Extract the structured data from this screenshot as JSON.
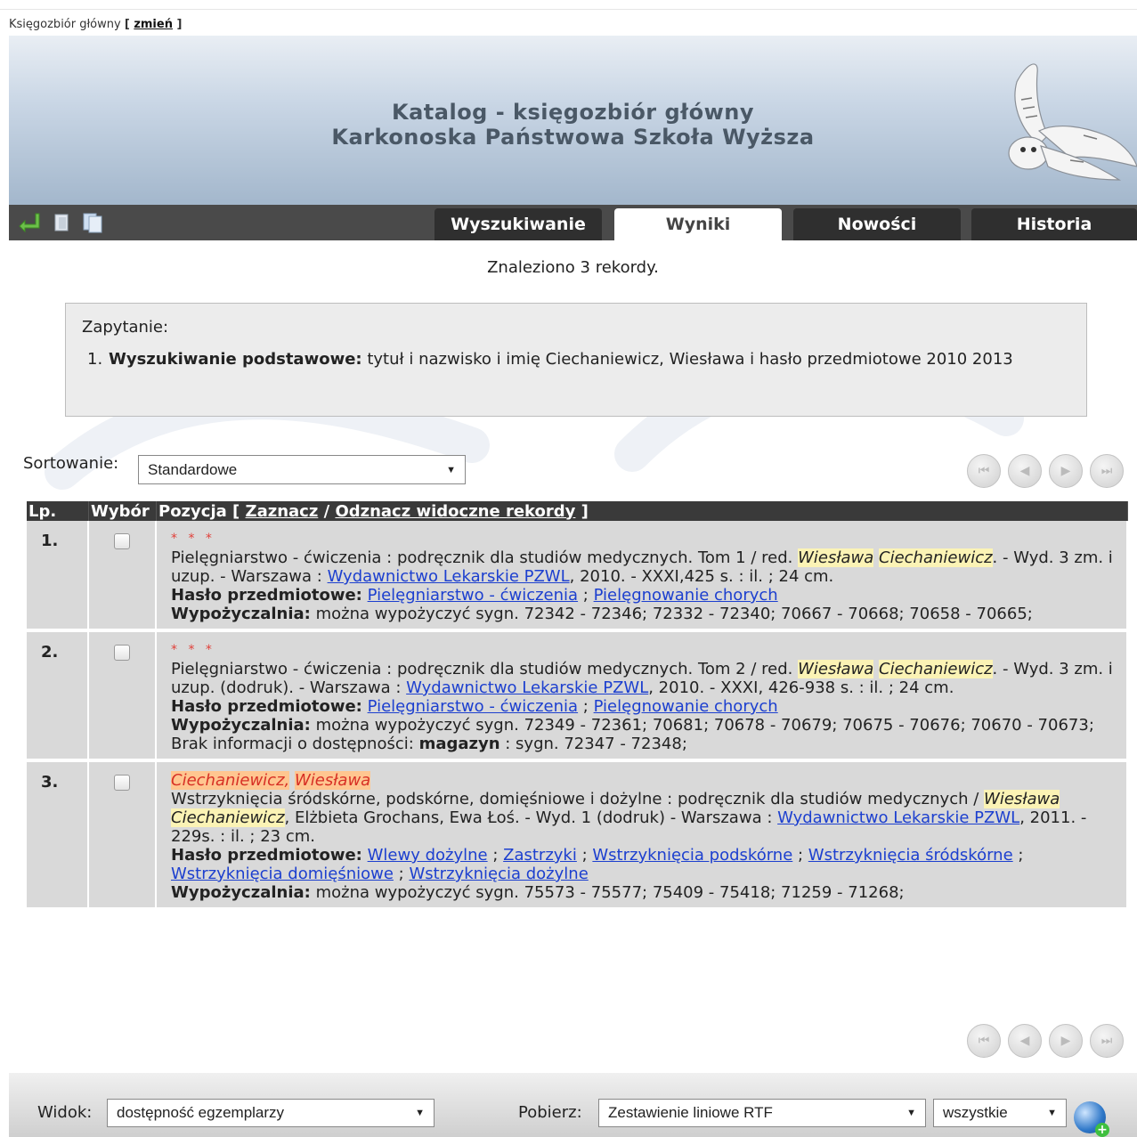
{
  "header": {
    "collection_label": "Księgozbiór główny",
    "change_link": "zmień",
    "title_line1": "Katalog - księgozbiór główny",
    "title_line2": "Karkonoska Państwowa Szkoła Wyższa"
  },
  "tabs": [
    {
      "label": "Wyszukiwanie"
    },
    {
      "label": "Wyniki",
      "active": true
    },
    {
      "label": "Nowości"
    },
    {
      "label": "Historia"
    }
  ],
  "results": {
    "found_text": "Znaleziono 3 rekordy.",
    "query_label": "Zapytanie:",
    "query_num": "1.",
    "query_bold": "Wyszukiwanie podstawowe:",
    "query_text": "tytuł i nazwisko i imię Ciechaniewicz, Wiesława i hasło przedmiotowe 2010 2013"
  },
  "sort": {
    "label": "Sortowanie:",
    "value": "Standardowe"
  },
  "table": {
    "col_lp": "Lp.",
    "col_choice": "Wybór",
    "col_pos": "Pozycja",
    "select_visible": "Zaznacz",
    "deselect_visible": "Odznacz widoczne rekordy"
  },
  "records": [
    {
      "lp": "1.",
      "stars": "* * *",
      "title_pre": "Pielęgniarstwo - ćwiczenia : podręcznik dla studiów medycznych. Tom 1 / red.",
      "hl1": "Wiesława",
      "hl2": "Ciechaniewicz",
      "title_post": ". - Wyd. 3 zm. i uzup. - Warszawa :",
      "publisher": "Wydawnictwo Lekarskie PZWL",
      "title_end": ", 2010. - XXXI,425 s. : il. ; 24 cm.",
      "subj_label": "Hasło przedmiotowe:",
      "subj1": "Pielęgniarstwo - ćwiczenia",
      "subj2": "Pielęgnowanie chorych",
      "lend_label": "Wypożyczalnia:",
      "lend_text": "można wypożyczyć sygn. 72342 - 72346; 72332 - 72340; 70667 - 70668; 70658 - 70665;"
    },
    {
      "lp": "2.",
      "stars": "* * *",
      "title_pre": "Pielęgniarstwo - ćwiczenia : podręcznik dla studiów medycznych. Tom 2 / red.",
      "hl1": "Wiesława",
      "hl2": "Ciechaniewicz",
      "title_post": ". - Wyd. 3 zm. i uzup. (dodruk). - Warszawa :",
      "publisher": "Wydawnictwo Lekarskie PZWL",
      "title_end": ", 2010. - XXXI, 426-938 s. : il. ; 24 cm.",
      "subj_label": "Hasło przedmiotowe:",
      "subj1": "Pielęgniarstwo - ćwiczenia",
      "subj2": "Pielęgnowanie chorych",
      "lend_label": "Wypożyczalnia:",
      "lend_text": "można wypożyczyć sygn. 72349 - 72361; 70681; 70678 - 70679; 70675 - 70676; 70670 - 70673;",
      "noinfo_text": "Brak informacji o dostępności:",
      "noinfo_bold": "magazyn",
      "noinfo_tail": ": sygn. 72347 - 72348;"
    },
    {
      "lp": "3.",
      "author1": "Ciechaniewicz,",
      "author2": "Wiesława",
      "title_pre": "Wstrzyknięcia śródskórne, podskórne, domięśniowe i dożylne : podręcznik dla studiów medycznych /",
      "hl1": "Wiesława",
      "hl2": "Ciechaniewicz",
      "title_post": ", Elżbieta Grochans, Ewa Łoś. - Wyd. 1 (dodruk) - Warszawa :",
      "publisher": "Wydawnictwo Lekarskie PZWL",
      "title_end": ", 2011. - 229s. : il. ; 23 cm.",
      "subj_label": "Hasło przedmiotowe:",
      "subj1": "Wlewy dożylne",
      "subj2": "Zastrzyki",
      "subj3": "Wstrzyknięcia podskórne",
      "subj4": "Wstrzyknięcia śródskórne",
      "subj5": "Wstrzyknięcia domięśniowe",
      "subj6": "Wstrzyknięcia dożylne",
      "lend_label": "Wypożyczalnia:",
      "lend_text": "można wypożyczyć sygn. 75573 - 75577; 75409 - 75418; 71259 - 71268;"
    }
  ],
  "footer": {
    "view_label": "Widok:",
    "view_value": "dostępność egzemplarzy",
    "download_label": "Pobierz:",
    "download_value": "Zestawienie liniowe RTF",
    "scope_value": "wszystkie"
  },
  "icons": [
    "return-icon",
    "copy-icon",
    "copy-all-icon",
    "first-page-icon",
    "prev-page-icon",
    "next-page-icon",
    "last-page-icon",
    "globe-download-icon"
  ]
}
